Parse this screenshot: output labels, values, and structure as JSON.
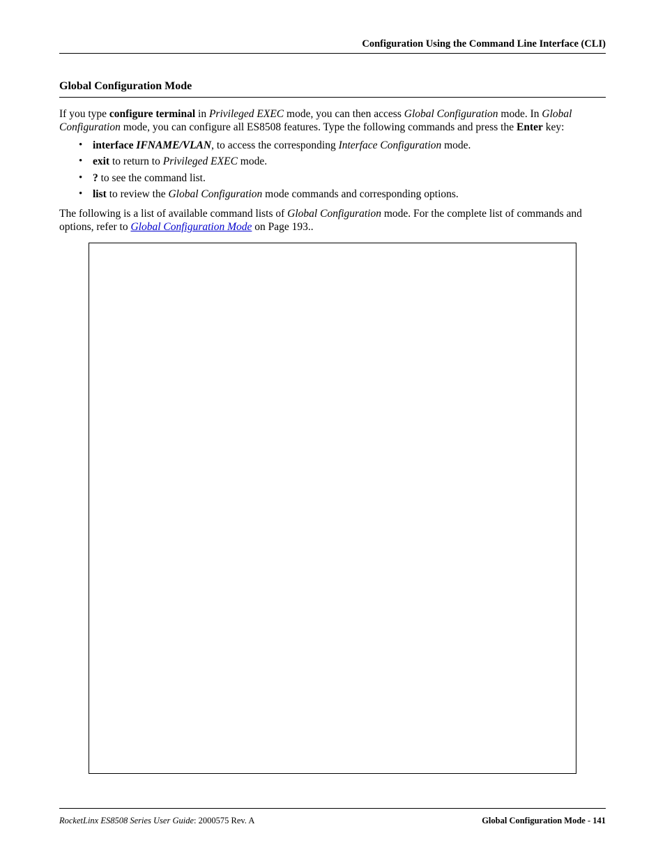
{
  "header": {
    "right": "Configuration Using the Command Line Interface (CLI)"
  },
  "section_heading": "Global Configuration Mode",
  "intro": {
    "pre1": "If you type ",
    "bold1": "configure terminal",
    "pre2": " in ",
    "italic1": "Privileged EXEC",
    "pre3": " mode, you can then access ",
    "italic2": "Global Configuration",
    "pre4": " mode. In ",
    "italic3": "Global Configuration",
    "pre5": " mode, you can configure all ES8508 features. Type the following commands and press the ",
    "bold2": "Enter",
    "pre6": " key:"
  },
  "bullets": [
    {
      "bold": "interface",
      "space": " ",
      "bolditalic": "IFNAME/VLAN",
      "rest1": ", to access the corresponding ",
      "italic": "Interface Configuration",
      "rest2": " mode."
    },
    {
      "bold": "exit",
      "rest1": " to return to ",
      "italic": "Privileged EXEC",
      "rest2": " mode."
    },
    {
      "bold": "?",
      "rest1": " to see the command list."
    },
    {
      "bold": "list",
      "rest1": " to review the ",
      "italic": "Global Configuration",
      "rest2": " mode commands and corresponding options."
    }
  ],
  "para2": {
    "pre1": "The following is a list of available command lists of ",
    "italic1": "Global Configuration",
    "pre2": " mode. For the complete list of commands and options, refer to ",
    "link": "Global Configuration Mode",
    "post": " on Page 193.."
  },
  "footer": {
    "left_italic": "RocketLinx ES8508 Series  User Guide",
    "left_rest": ": 2000575 Rev. A",
    "right": "Global Configuration Mode - 141"
  }
}
